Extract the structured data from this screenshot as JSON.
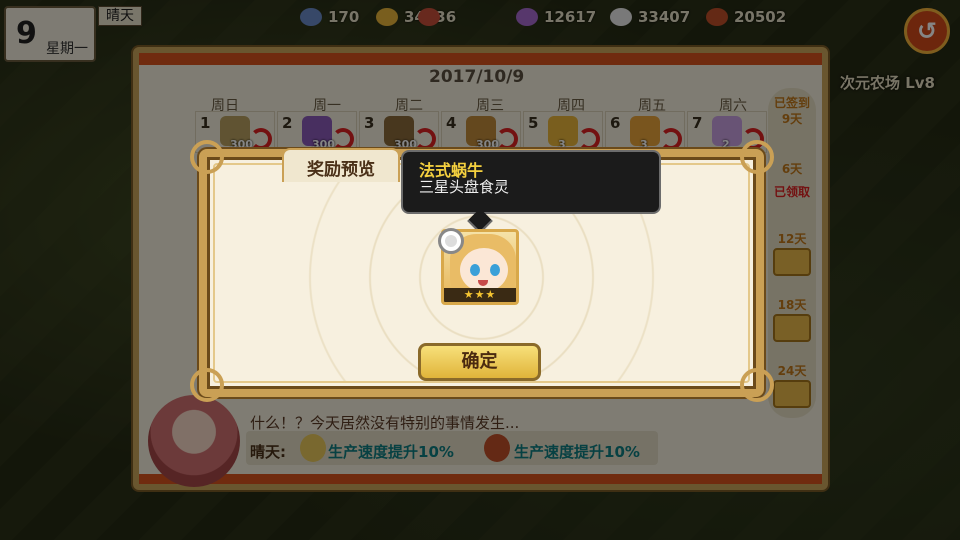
{
  "hud": {
    "day_number": "9",
    "weekday": "星期一",
    "weather": "晴天",
    "resources": [
      {
        "name": "gem",
        "icon": "gem-icon",
        "value": "170",
        "color": "#6a8ac8"
      },
      {
        "name": "gold",
        "icon": "coin-icon",
        "value": "34436",
        "color": "#e8b43a"
      },
      {
        "name": "crystal",
        "icon": "crystal-icon",
        "value": "12617",
        "color": "#a86ad0"
      },
      {
        "name": "chicken",
        "icon": "chicken-icon",
        "value": "33407",
        "color": "#e8e8e8"
      },
      {
        "name": "meat",
        "icon": "meat-icon",
        "value": "20502",
        "color": "#c0502a"
      }
    ]
  },
  "calendar": {
    "date": "2017/10/9",
    "farm_title": "次元农场 Lv8",
    "weekdays": [
      "周日",
      "周一",
      "周二",
      "周三",
      "周四",
      "周五",
      "周六"
    ],
    "days": [
      {
        "n": "1",
        "qty": "300",
        "color": "#b8a060"
      },
      {
        "n": "2",
        "qty": "300",
        "color": "#8a5ab8"
      },
      {
        "n": "3",
        "qty": "300",
        "color": "#8a6a3a"
      },
      {
        "n": "4",
        "qty": "300",
        "color": "#c08a3a"
      },
      {
        "n": "5",
        "qty": "3",
        "color": "#e8b43a"
      },
      {
        "n": "6",
        "qty": "3",
        "color": "#e8a43a"
      },
      {
        "n": "7",
        "qty": "2",
        "color": "#c8a0e0"
      }
    ],
    "sidebar": {
      "checked_label": "已签到",
      "checked_days": "9天",
      "tiers": [
        {
          "label": "6天",
          "status": "已领取"
        },
        {
          "label": "12天"
        },
        {
          "label": "18天"
        },
        {
          "label": "24天"
        }
      ]
    },
    "message": "什么！？今天居然没有特别的事情发生...",
    "buff_weather": "晴天:",
    "buffs": [
      "生产速度提升10%",
      "生产速度提升10%"
    ]
  },
  "modal": {
    "tab_title": "奖励预览",
    "tooltip_name": "法式蜗牛",
    "tooltip_desc": "三星头盘食灵",
    "card_stars": "★★★",
    "confirm_label": "确定"
  },
  "colors": {
    "accent": "#d6541d",
    "frame": "#caa055",
    "buff_text": "#0f7d80"
  }
}
